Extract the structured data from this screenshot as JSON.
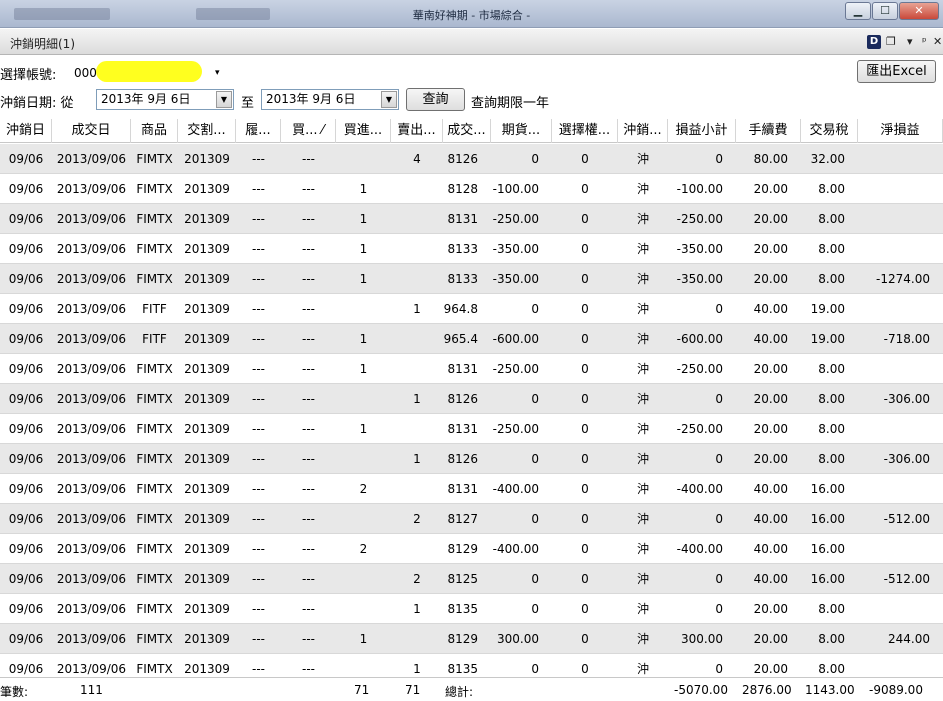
{
  "window": {
    "title": "華南好神期 - 市場綜合 -",
    "min_glyph": "▁",
    "max_glyph": "☐",
    "close_glyph": "✕"
  },
  "panel": {
    "title": "沖銷明細(1)",
    "logo_letter": "D",
    "icon_glyphs": {
      "restore": "❐",
      "menu": "▾",
      "pin": "ᵖ",
      "close": "✕"
    }
  },
  "controls": {
    "account_label": "選擇帳號:",
    "account_value": "000",
    "account_arrow": "▾",
    "export_button": "匯出Excel",
    "date_label": "沖銷日期: 從",
    "date_from": "2013年  9月  6日",
    "date_sep": "至",
    "date_to": "2013年  9月  6日",
    "dropdown_glyph": "▼",
    "query_button": "查詢",
    "query_note": "查詢期限一年"
  },
  "columns": [
    "沖銷日",
    "成交日",
    "商品",
    "交割...",
    "履...",
    "買... ⁄",
    "買進...",
    "賣出...",
    "成交...",
    "期貨...",
    "選擇權...",
    "沖銷...",
    "損益小計",
    "手續費",
    "交易稅",
    "淨損益"
  ],
  "rows": [
    [
      "09/06",
      "2013/09/06",
      "FIMTX",
      "201309",
      "---",
      "---",
      "",
      "4",
      "8126",
      "0",
      "0",
      "沖",
      "0",
      "80.00",
      "32.00",
      ""
    ],
    [
      "09/06",
      "2013/09/06",
      "FIMTX",
      "201309",
      "---",
      "---",
      "1",
      "",
      "8128",
      "-100.00",
      "0",
      "沖",
      "-100.00",
      "20.00",
      "8.00",
      ""
    ],
    [
      "09/06",
      "2013/09/06",
      "FIMTX",
      "201309",
      "---",
      "---",
      "1",
      "",
      "8131",
      "-250.00",
      "0",
      "沖",
      "-250.00",
      "20.00",
      "8.00",
      ""
    ],
    [
      "09/06",
      "2013/09/06",
      "FIMTX",
      "201309",
      "---",
      "---",
      "1",
      "",
      "8133",
      "-350.00",
      "0",
      "沖",
      "-350.00",
      "20.00",
      "8.00",
      ""
    ],
    [
      "09/06",
      "2013/09/06",
      "FIMTX",
      "201309",
      "---",
      "---",
      "1",
      "",
      "8133",
      "-350.00",
      "0",
      "沖",
      "-350.00",
      "20.00",
      "8.00",
      "-1274.00"
    ],
    [
      "09/06",
      "2013/09/06",
      "FITF",
      "201309",
      "---",
      "---",
      "",
      "1",
      "964.8",
      "0",
      "0",
      "沖",
      "0",
      "40.00",
      "19.00",
      ""
    ],
    [
      "09/06",
      "2013/09/06",
      "FITF",
      "201309",
      "---",
      "---",
      "1",
      "",
      "965.4",
      "-600.00",
      "0",
      "沖",
      "-600.00",
      "40.00",
      "19.00",
      "-718.00"
    ],
    [
      "09/06",
      "2013/09/06",
      "FIMTX",
      "201309",
      "---",
      "---",
      "1",
      "",
      "8131",
      "-250.00",
      "0",
      "沖",
      "-250.00",
      "20.00",
      "8.00",
      ""
    ],
    [
      "09/06",
      "2013/09/06",
      "FIMTX",
      "201309",
      "---",
      "---",
      "",
      "1",
      "8126",
      "0",
      "0",
      "沖",
      "0",
      "20.00",
      "8.00",
      "-306.00"
    ],
    [
      "09/06",
      "2013/09/06",
      "FIMTX",
      "201309",
      "---",
      "---",
      "1",
      "",
      "8131",
      "-250.00",
      "0",
      "沖",
      "-250.00",
      "20.00",
      "8.00",
      ""
    ],
    [
      "09/06",
      "2013/09/06",
      "FIMTX",
      "201309",
      "---",
      "---",
      "",
      "1",
      "8126",
      "0",
      "0",
      "沖",
      "0",
      "20.00",
      "8.00",
      "-306.00"
    ],
    [
      "09/06",
      "2013/09/06",
      "FIMTX",
      "201309",
      "---",
      "---",
      "2",
      "",
      "8131",
      "-400.00",
      "0",
      "沖",
      "-400.00",
      "40.00",
      "16.00",
      ""
    ],
    [
      "09/06",
      "2013/09/06",
      "FIMTX",
      "201309",
      "---",
      "---",
      "",
      "2",
      "8127",
      "0",
      "0",
      "沖",
      "0",
      "40.00",
      "16.00",
      "-512.00"
    ],
    [
      "09/06",
      "2013/09/06",
      "FIMTX",
      "201309",
      "---",
      "---",
      "2",
      "",
      "8129",
      "-400.00",
      "0",
      "沖",
      "-400.00",
      "40.00",
      "16.00",
      ""
    ],
    [
      "09/06",
      "2013/09/06",
      "FIMTX",
      "201309",
      "---",
      "---",
      "",
      "2",
      "8125",
      "0",
      "0",
      "沖",
      "0",
      "40.00",
      "16.00",
      "-512.00"
    ],
    [
      "09/06",
      "2013/09/06",
      "FIMTX",
      "201309",
      "---",
      "---",
      "",
      "1",
      "8135",
      "0",
      "0",
      "沖",
      "0",
      "20.00",
      "8.00",
      ""
    ],
    [
      "09/06",
      "2013/09/06",
      "FIMTX",
      "201309",
      "---",
      "---",
      "1",
      "",
      "8129",
      "300.00",
      "0",
      "沖",
      "300.00",
      "20.00",
      "8.00",
      "244.00"
    ],
    [
      "09/06",
      "2013/09/06",
      "FIMTX",
      "201309",
      "---",
      "---",
      "",
      "1",
      "8135",
      "0",
      "0",
      "沖",
      "0",
      "20.00",
      "8.00",
      ""
    ]
  ],
  "footer": {
    "count_label": "筆數:",
    "count_value": "111",
    "buy_total": "71",
    "sell_total": "71",
    "total_label": "總計:",
    "pnl_total": "-5070.00",
    "fee_total": "2876.00",
    "tax_total": "1143.00",
    "net_total": "-9089.00"
  }
}
